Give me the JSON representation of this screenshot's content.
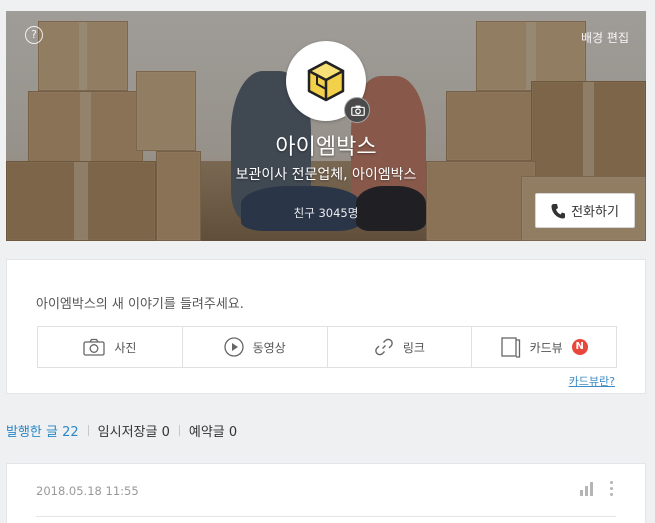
{
  "cover": {
    "help_icon": "?",
    "bg_edit_label": "배경 편집",
    "channel_name": "아이엠박스",
    "channel_desc": "보관이사 전문업체, 아이엠박스",
    "friends_text": "친구 3045명",
    "call_label": "전화하기",
    "icons": [
      "help-icon",
      "cube-icon",
      "camera-icon",
      "phone-icon"
    ]
  },
  "composer": {
    "prompt": "아이엠박스의 새 이야기를 들려주세요.",
    "actions": [
      {
        "label": "사진",
        "icon": "camera-icon"
      },
      {
        "label": "동영상",
        "icon": "play-icon"
      },
      {
        "label": "링크",
        "icon": "link-icon"
      },
      {
        "label": "카드뷰",
        "icon": "cardview-icon",
        "badge": "N"
      }
    ],
    "cardview_help": "카드뷰란?"
  },
  "tabs": [
    {
      "label": "발행한 글 22",
      "active": true
    },
    {
      "label": "임시저장글 0",
      "active": false
    },
    {
      "label": "예약글 0",
      "active": false
    }
  ],
  "post": {
    "date": "2018.05.18 11:55",
    "icons": [
      "stats-icon",
      "more-icon"
    ]
  },
  "colors": {
    "accent": "#2b88c7",
    "badge": "#e8473b",
    "cube": "#f2d04a"
  }
}
